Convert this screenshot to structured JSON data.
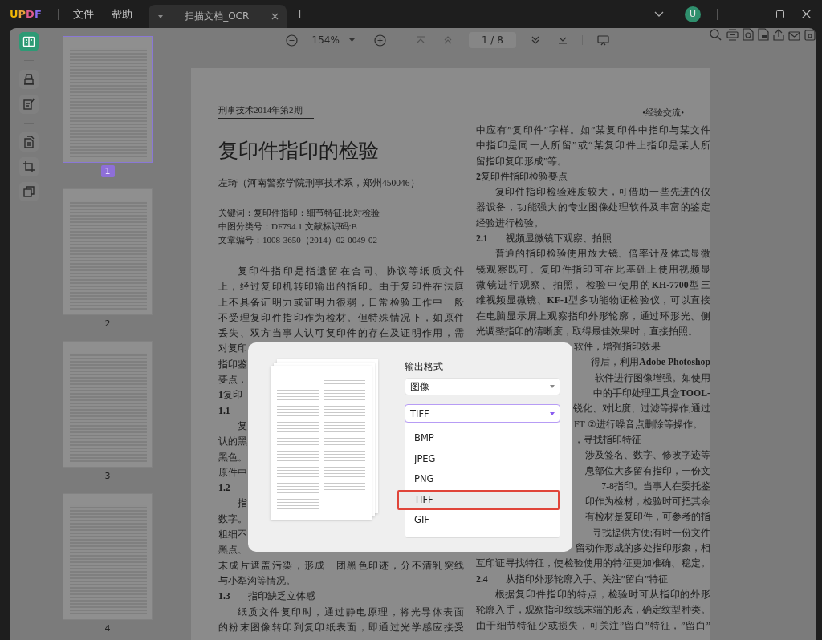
{
  "app": {
    "logo": "UPDF",
    "menus": [
      "文件",
      "帮助"
    ]
  },
  "tabs": [
    {
      "label": "扫描文档_OCR",
      "selected": true
    }
  ],
  "account": {
    "initial": "U"
  },
  "toolbar": {
    "zoom": "154%",
    "page": "1 / 8"
  },
  "left_tools": [
    {
      "kind": "reader",
      "selected": true
    },
    {
      "kind": "highlight",
      "selected": false
    },
    {
      "kind": "edit",
      "selected": false
    },
    {
      "kind": "pages",
      "selected": false
    },
    {
      "kind": "crop",
      "selected": false
    },
    {
      "kind": "layers",
      "selected": false
    }
  ],
  "thumbnails": [
    {
      "label": "1",
      "selected": true
    },
    {
      "label": "2",
      "selected": false
    },
    {
      "label": "3",
      "selected": false
    },
    {
      "label": "4",
      "selected": false
    }
  ],
  "document": {
    "journal": "刑事技术2014年第2期",
    "section": "•经验交流•",
    "title": "复印件指印的检验",
    "author": "左琦（河南警察学院刑事技术系，郑州450046）",
    "meta": [
      "关键词：复印件指印：细节特征:比对检验",
      "中图分类号：DF794.1 文献标识码:B",
      "文章编号：1008-3650（2014）02-0049-02"
    ],
    "left_column": [
      {
        "kind": "first",
        "text": "复印件指印是指遗留在合同、协议等纸质文件"
      },
      {
        "kind": "full",
        "text": "上，经过复印机转印输出的指印。由于复印件在法庭"
      },
      {
        "kind": "full",
        "text": "上不具备证明力或证明力很弱，日常检验工作中一般"
      },
      {
        "kind": "full",
        "text": "不受理复印件指印作为检材。但特殊情况下，如原件"
      },
      {
        "kind": "full",
        "text": "丢失、双方当事人认可复印件的存在及证明作用，需"
      },
      {
        "kind": "cut",
        "text": "对复印"
      },
      {
        "kind": "cut",
        "text": "指印鉴"
      },
      {
        "kind": "cut",
        "text": "要点，"
      },
      {
        "kind": "cut",
        "text": "**1**复印"
      },
      {
        "kind": "cut",
        "text": "**1.1**"
      },
      {
        "kind": "cut-first",
        "text": "复"
      },
      {
        "kind": "cut",
        "text": "认的黑"
      },
      {
        "kind": "cut",
        "text": "黑色。"
      },
      {
        "kind": "cut",
        "text": "原件中"
      },
      {
        "kind": "cut",
        "text": "**1.2**"
      },
      {
        "kind": "cut-first",
        "text": "指"
      },
      {
        "kind": "cut",
        "text": "数字。"
      },
      {
        "kind": "cut",
        "text": "粗细不"
      },
      {
        "kind": "cut",
        "text": "黑点、"
      },
      {
        "kind": "full",
        "text": "末成片遮盖污染，形成一团黑色印迹，分不清乳突线"
      },
      {
        "kind": "end",
        "text": "与小犁沟等情况。"
      },
      {
        "kind": "heading",
        "number": "1.3",
        "text": "指印缺乏立体感"
      },
      {
        "kind": "first",
        "text": "纸质文件复印时，通过静电原理，将光导体表面"
      },
      {
        "kind": "full",
        "text": "的粉末图像转印到复印纸表面，即通过光学感应接受"
      }
    ],
    "right_column": [
      {
        "kind": "full",
        "text": "中应有”复印件”字样。如”某复印件中指印与某文件"
      },
      {
        "kind": "full",
        "text": "中指印是同一人所留”或“某复印件上指印是某人所"
      },
      {
        "kind": "end",
        "text": "留指印复印形成”等。"
      },
      {
        "kind": "end",
        "text": "**2**复印件指印检验要点"
      },
      {
        "kind": "first",
        "text": "复印件指印检验难度较大，可借助一些先进的仪"
      },
      {
        "kind": "full",
        "text": "器设备，功能强大的专业图像处理软件及丰富的鉴定"
      },
      {
        "kind": "end",
        "text": "经验进行检验。"
      },
      {
        "kind": "heading",
        "number": "2.1",
        "text": "视频显微镜下观察、拍照"
      },
      {
        "kind": "first",
        "text": "普通的指印检验使用放大镜、倍率计及体式显微"
      },
      {
        "kind": "full",
        "text": "镜观察既可。复印件指印可在此基础上使用视频显"
      },
      {
        "kind": "full",
        "text": "微镜进行观察、拍照。检验中使用的**KH-7700**型三"
      },
      {
        "kind": "full",
        "text": "维视频显微镜、**KF-1**型多功能物证检验仪，可以直接"
      },
      {
        "kind": "full",
        "text": "在电脑显示屏上观察指印外形轮廓，通过环形光、侧"
      },
      {
        "kind": "end",
        "text": "光调整指印的清晰度，取得最佳效果时，直接拍照。"
      },
      {
        "kind": "cut-end",
        "text": "软件，增强指印效果"
      },
      {
        "kind": "cut",
        "text": "得后，利用**Adobe Photoshop**"
      },
      {
        "kind": "cut",
        "text": "软件进行图像增强。如使用"
      },
      {
        "kind": "cut",
        "text": "中的手印处理工具盒**TOOL-**"
      },
      {
        "kind": "cut",
        "text": "锐化、对比度、过滤等操作;通过"
      },
      {
        "kind": "cut-end",
        "text": "FT ②进行噪音点删除等操作。"
      },
      {
        "kind": "cut-end",
        "text": "，寻找指印特征"
      },
      {
        "kind": "cut",
        "text": "涉及签名、数字、修改字迹等"
      },
      {
        "kind": "cut",
        "text": "息部位大多留有指印，一份文"
      },
      {
        "kind": "cut",
        "text": "7-8指印。当事人在委托鉴"
      },
      {
        "kind": "cut",
        "text": "印作为检材，检验时可把其余"
      },
      {
        "kind": "cut",
        "text": "有检材是复印件，可参考的指"
      },
      {
        "kind": "cut",
        "text": "寻找提供方便;有时一份文件"
      },
      {
        "kind": "cut",
        "text": "留动作形成的多处指印形象，相"
      },
      {
        "kind": "full",
        "text": "互印证寻找特征，使检验使用的特征更加准确、稳定。"
      },
      {
        "kind": "heading",
        "number": "2.4",
        "text": "从指印外形轮廓入手、关注”留白”特征"
      },
      {
        "kind": "first",
        "text": "根据复印件指印的特点，检验时可从指印的外形"
      },
      {
        "kind": "full",
        "text": "轮廓入手，观察指印纹线末端的形态，确定纹型种类。"
      },
      {
        "kind": "full",
        "text": "由于细节特征少或损失，可关注”留白”特征，”留白”"
      }
    ]
  },
  "dialog": {
    "label": "输出格式",
    "format": "图像",
    "image_type": "TIFF",
    "options": [
      {
        "label": "BMP",
        "selected": false
      },
      {
        "label": "JPEG",
        "selected": false
      },
      {
        "label": "PNG",
        "selected": false
      },
      {
        "label": "TIFF",
        "selected": true
      },
      {
        "label": "GIF",
        "selected": false
      }
    ]
  }
}
